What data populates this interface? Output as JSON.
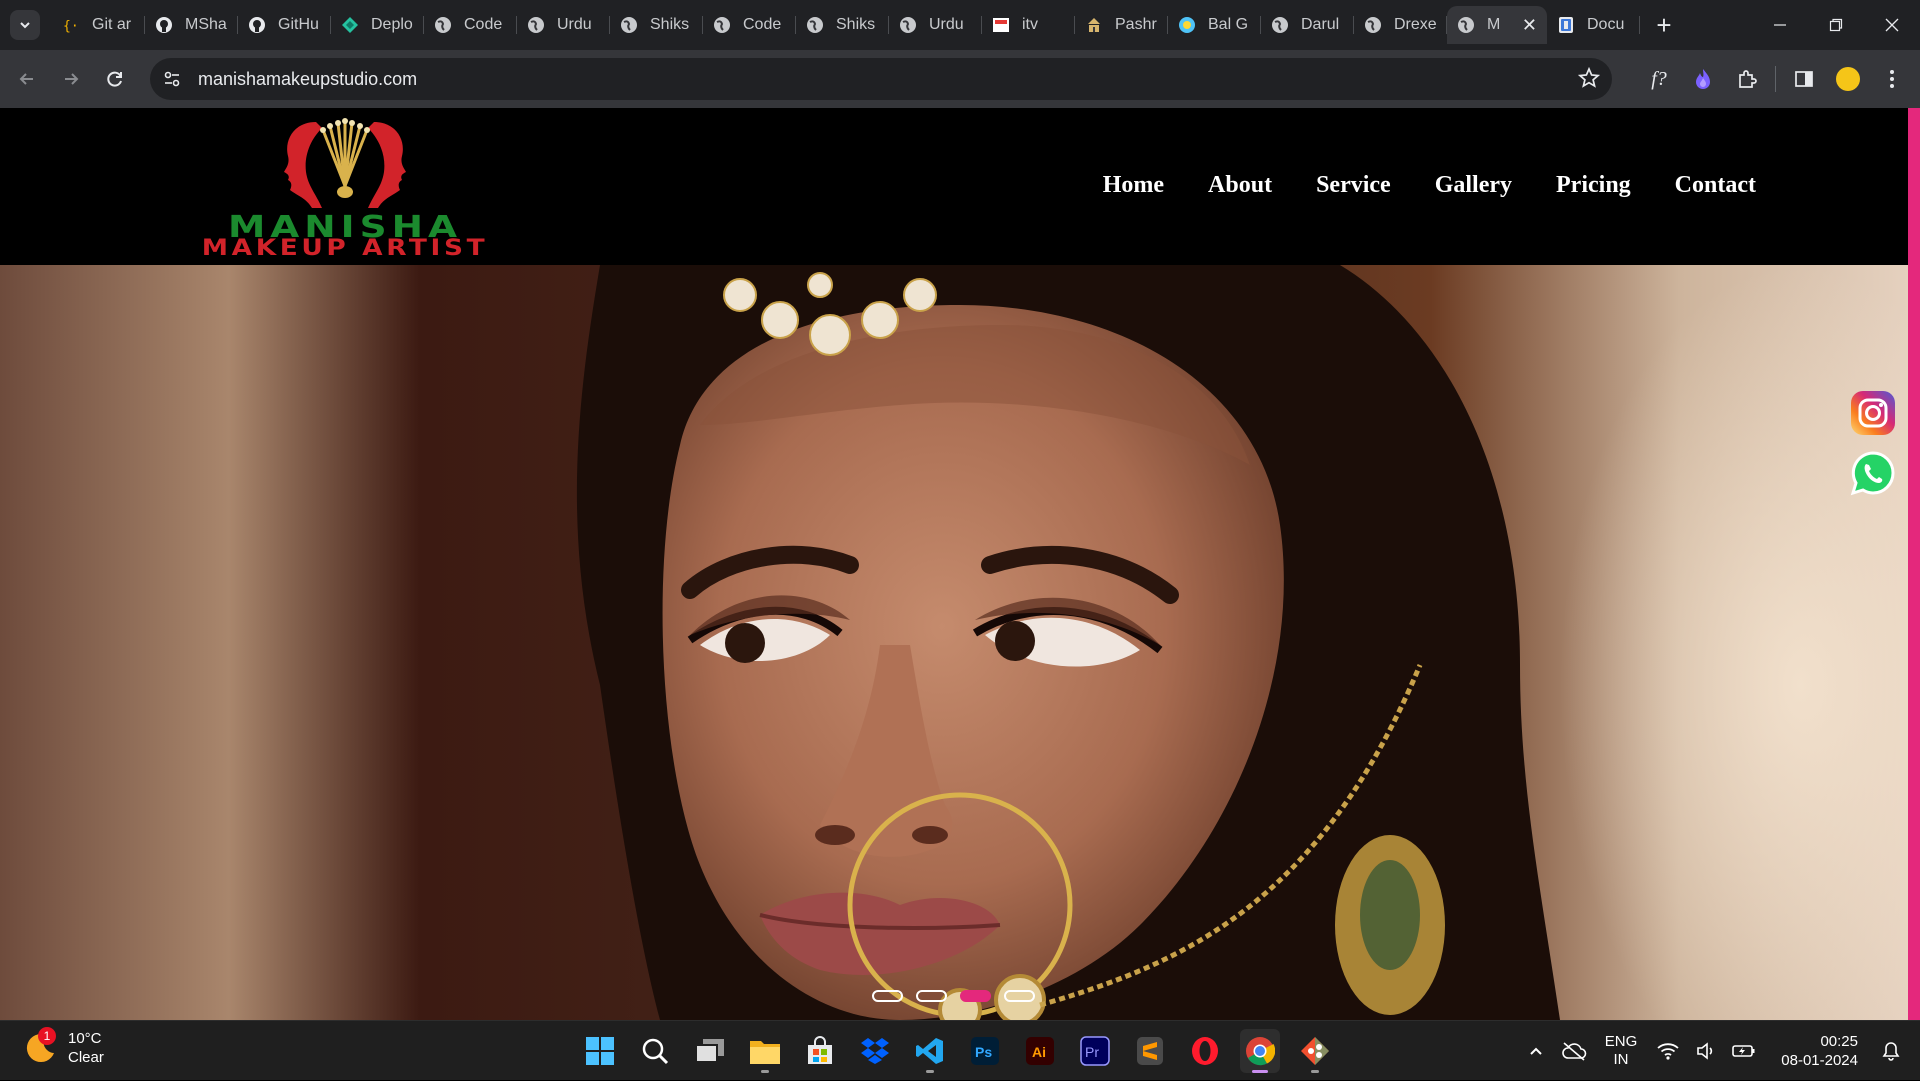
{
  "browser": {
    "tabs": [
      {
        "title": "Git ar",
        "icon": "code-braces-icon"
      },
      {
        "title": "MSha",
        "icon": "github-icon"
      },
      {
        "title": "GitHu",
        "icon": "github-icon"
      },
      {
        "title": "Deplo",
        "icon": "netlify-icon"
      },
      {
        "title": "Code",
        "icon": "globe-icon"
      },
      {
        "title": "Urdu",
        "icon": "globe-icon"
      },
      {
        "title": "Shiks",
        "icon": "globe-icon"
      },
      {
        "title": "Code",
        "icon": "globe-icon"
      },
      {
        "title": "Shiks",
        "icon": "globe-icon"
      },
      {
        "title": "Urdu",
        "icon": "globe-icon"
      },
      {
        "title": "itv",
        "icon": "itv-icon"
      },
      {
        "title": "Pashr",
        "icon": "temple-icon"
      },
      {
        "title": "Bal G",
        "icon": "bal-icon"
      },
      {
        "title": "Darul",
        "icon": "globe-icon"
      },
      {
        "title": "Drexe",
        "icon": "globe-icon"
      },
      {
        "title": "M",
        "icon": "globe-icon",
        "active": true
      },
      {
        "title": "Docu",
        "icon": "document-icon"
      }
    ],
    "url": "manishamakeupstudio.com",
    "extension_label": "f?"
  },
  "site": {
    "logo_line1": "MANISHA",
    "logo_line2": "MAKEUP ARTIST",
    "nav": [
      "Home",
      "About",
      "Service",
      "Gallery",
      "Pricing",
      "Contact"
    ],
    "slider": {
      "count": 4,
      "active_index": 2
    },
    "accent_color": "#e4287c"
  },
  "taskbar": {
    "weather_temp": "10°C",
    "weather_desc": "Clear",
    "weather_badge": "1",
    "lang_line1": "ENG",
    "lang_line2": "IN",
    "time": "00:25",
    "date": "08-01-2024"
  }
}
